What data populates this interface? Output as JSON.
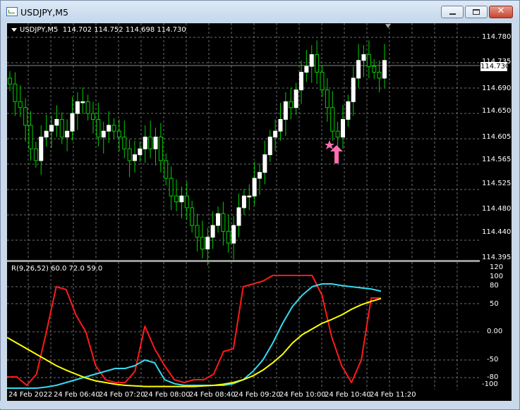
{
  "window": {
    "title": "USDJPY,M5",
    "controls": [
      "minimize",
      "maximize",
      "close"
    ]
  },
  "chart_header": {
    "symbol": "USDJPY,M5",
    "ohlc": "114.702 114.752 114.698 114.730"
  },
  "price_axis": {
    "labels": [
      "114.780",
      "114.735",
      "114.690",
      "114.650",
      "114.605",
      "114.565",
      "114.525",
      "114.480",
      "114.440",
      "114.395"
    ],
    "current_price": "114.730"
  },
  "indicator": {
    "header": "R(9,26,52) 60.0 72.0 59.0",
    "axis_labels": [
      "120",
      "100",
      "80",
      "50",
      "0.00",
      "-50",
      "-80",
      "-100"
    ]
  },
  "time_axis": {
    "labels": [
      "24 Feb 2022",
      "24 Feb 06:40",
      "24 Feb 07:20",
      "24 Feb 08:00",
      "24 Feb 08:40",
      "24 Feb 09:20",
      "24 Feb 10:00",
      "24 Feb 10:40",
      "24 Feb 11:20"
    ]
  },
  "colors": {
    "background": "#000000",
    "grid": "#6e6e6e",
    "candle_up": "#ffffff",
    "wick": "#00d000",
    "arrow": "#ff6fb1",
    "line_red": "#ff1a1a",
    "line_cyan": "#33dcf0",
    "line_yellow": "#ffff00"
  },
  "icons": [
    "window-app-icon",
    "dropdown-triangle-icon",
    "buy-arrow-icon",
    "star-icon"
  ],
  "chart_data": [
    {
      "type": "candlestick",
      "title": "USDJPY,M5",
      "ylim": [
        114.395,
        114.78
      ],
      "x_labels": [
        "24 Feb 2022",
        "24 Feb 06:40",
        "24 Feb 07:20",
        "24 Feb 08:00",
        "24 Feb 08:40",
        "24 Feb 09:20",
        "24 Feb 10:00",
        "24 Feb 10:40",
        "24 Feb 11:20"
      ],
      "close": [
        114.69,
        114.66,
        114.65,
        114.62,
        114.58,
        114.56,
        114.6,
        114.61,
        114.62,
        114.63,
        114.6,
        114.61,
        114.64,
        114.66,
        114.66,
        114.64,
        114.63,
        114.6,
        114.61,
        114.62,
        114.61,
        114.6,
        114.58,
        114.56,
        114.57,
        114.58,
        114.6,
        114.58,
        114.6,
        114.56,
        114.53,
        114.5,
        114.49,
        114.5,
        114.48,
        114.45,
        114.43,
        114.41,
        114.43,
        114.45,
        114.47,
        114.44,
        114.42,
        114.45,
        114.48,
        114.5,
        114.5,
        114.53,
        114.54,
        114.57,
        114.6,
        114.61,
        114.63,
        114.66,
        114.65,
        114.68,
        114.71,
        114.72,
        114.74,
        114.71,
        114.68,
        114.65,
        114.61,
        114.6,
        114.63,
        114.66,
        114.7,
        114.73,
        114.74,
        114.72,
        114.71,
        114.7,
        114.73
      ],
      "note": "approximate price path read from candle bodies"
    },
    {
      "type": "line",
      "title": "R(9,26,52) 60.0 72.0 59.0",
      "ylim": [
        -100,
        120
      ],
      "series": [
        {
          "name": "R(9)",
          "values": [
            -80,
            -80,
            -95,
            -75,
            0,
            80,
            75,
            30,
            0,
            -60,
            -85,
            -90,
            -90,
            -70,
            10,
            -30,
            -60,
            -85,
            -90,
            -85,
            -85,
            -75,
            -35,
            -30,
            80,
            85,
            90,
            100,
            100,
            100,
            100,
            100,
            65,
            -10,
            -60,
            -90,
            -50,
            60,
            60
          ]
        },
        {
          "name": "R(26)",
          "values": [
            -100,
            -100,
            -100,
            -100,
            -98,
            -95,
            -90,
            -85,
            -80,
            -75,
            -70,
            -65,
            -65,
            -60,
            -50,
            -55,
            -85,
            -92,
            -95,
            -95,
            -95,
            -95,
            -95,
            -92,
            -85,
            -70,
            -50,
            -20,
            15,
            45,
            65,
            80,
            85,
            85,
            82,
            80,
            78,
            76,
            72
          ]
        },
        {
          "name": "R(52)",
          "values": [
            -10,
            -20,
            -30,
            -40,
            -50,
            -60,
            -68,
            -75,
            -82,
            -87,
            -90,
            -93,
            -95,
            -96,
            -97,
            -97,
            -97,
            -97,
            -97,
            -97,
            -96,
            -95,
            -93,
            -90,
            -85,
            -78,
            -68,
            -55,
            -40,
            -20,
            -5,
            5,
            15,
            22,
            30,
            40,
            48,
            54,
            59
          ]
        }
      ]
    }
  ]
}
